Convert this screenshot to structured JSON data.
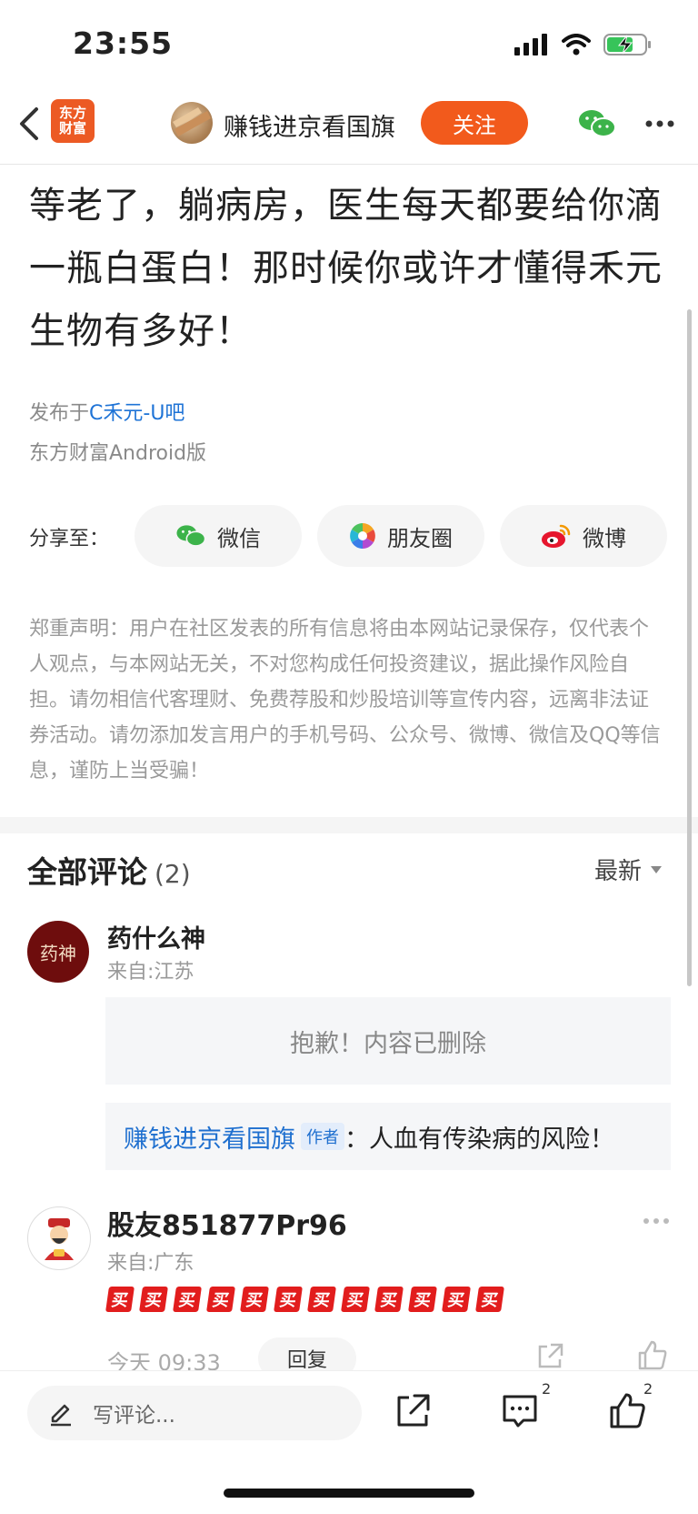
{
  "status_bar": {
    "time": "23:55",
    "icons": [
      "signal-icon",
      "wifi-icon",
      "battery-charging-icon"
    ]
  },
  "nav": {
    "app_logo_text": "东方\n财富",
    "author_name": "赚钱进京看国旗",
    "follow_label": "关注",
    "icons": [
      "back-icon",
      "wechat-icon",
      "more-icon"
    ]
  },
  "post": {
    "title": "等老了，躺病房，医生每天都要给你滴一瓶白蛋白！那时候你或许才懂得禾元生物有多好！",
    "published_prefix": "发布于",
    "bar_name": "C禾元-U吧",
    "client": "东方财富Android版"
  },
  "share": {
    "label": "分享至：",
    "targets": [
      {
        "label": "微信",
        "icon": "wechat-icon"
      },
      {
        "label": "朋友圈",
        "icon": "moments-icon"
      },
      {
        "label": "微博",
        "icon": "weibo-icon"
      }
    ]
  },
  "disclaimer": "郑重声明：用户在社区发表的所有信息将由本网站记录保存，仅代表个人观点，与本网站无关，不对您构成任何投资建议，据此操作风险自担。请勿相信代客理财、免费荐股和炒股培训等宣传内容，远离非法证券活动。请勿添加发言用户的手机号码、公众号、微博、微信及QQ等信息，谨防上当受骗！",
  "comments": {
    "title": "全部评论",
    "count": "(2)",
    "sort_label": "最新",
    "items": [
      {
        "avatar_text": "药神",
        "name": "药什么神",
        "from": "来自:江苏",
        "deleted_text": "抱歉！内容已删除",
        "reply": {
          "author": "赚钱进京看国旗",
          "tag": "作者",
          "separator": "：",
          "text": "人血有传染病的风险！"
        }
      },
      {
        "name": "股友851877Pr96",
        "from": "来自:广东",
        "sticker_char": "买",
        "sticker_count": 12,
        "time": "今天 09:33",
        "reply_label": "回复"
      }
    ]
  },
  "bottom_bar": {
    "input_placeholder": "写评论...",
    "comment_badge": "2",
    "like_badge": "2"
  },
  "colors": {
    "accent_orange": "#f25a1c",
    "link_blue": "#1e73d6",
    "sticker_red": "#e21d1d"
  }
}
